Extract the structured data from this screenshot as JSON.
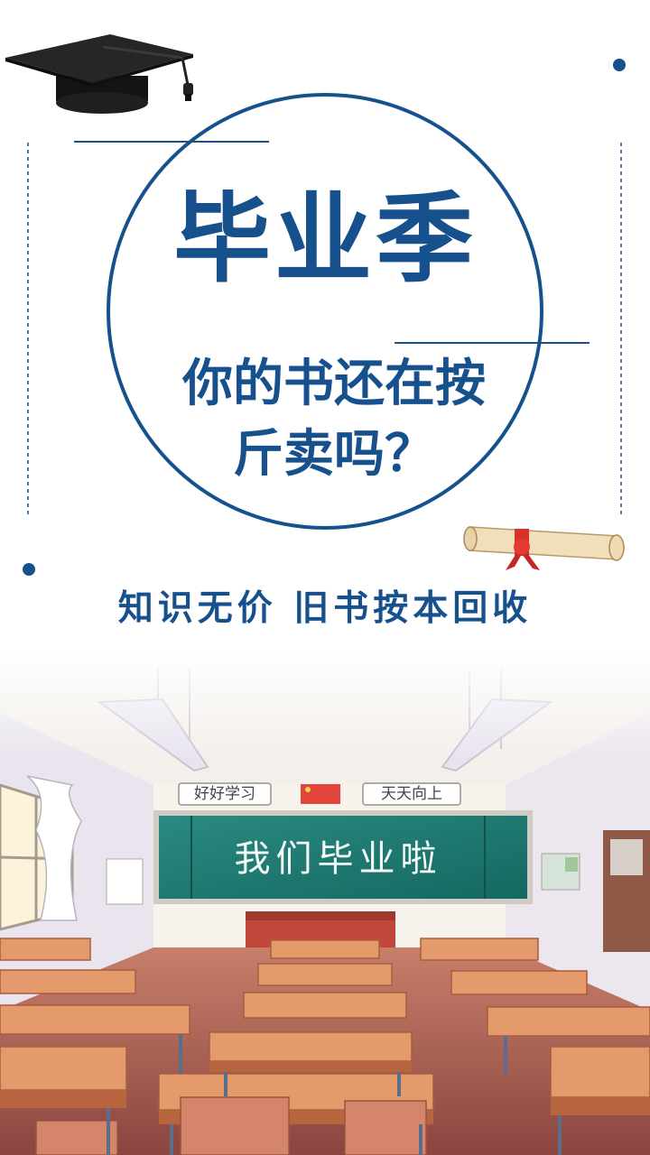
{
  "headline": "毕业季",
  "question": {
    "line1": "你的书还在按",
    "line2": "斤卖吗？"
  },
  "tagline": "知识无价 旧书按本回收",
  "classroom": {
    "sign_left": "好好学习",
    "sign_right": "天天向上",
    "blackboard": "我们毕业啦"
  },
  "colors": {
    "accent": "#16518e",
    "ribbon": "#d8322b",
    "board": "#1f7a72"
  },
  "icons": [
    "graduation-cap-icon",
    "diploma-scroll-icon",
    "flag-icon"
  ]
}
